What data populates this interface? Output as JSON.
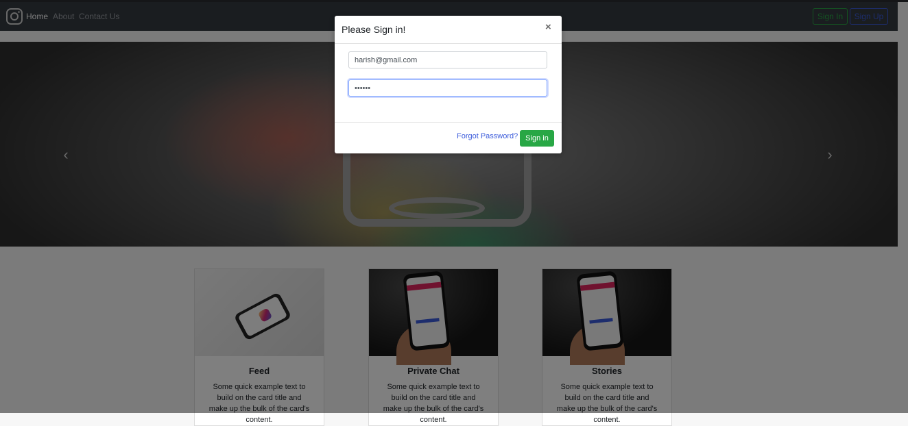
{
  "navbar": {
    "links": [
      {
        "label": "Home",
        "active": true
      },
      {
        "label": "About",
        "active": false
      },
      {
        "label": "Contact Us",
        "active": false
      }
    ],
    "sign_in_label": "Sign In",
    "sign_up_label": "Sign Up",
    "brand_icon": "instagram-icon"
  },
  "carousel": {
    "prev_icon": "chevron-left-icon",
    "next_icon": "chevron-right-icon",
    "prev_glyph": "‹",
    "next_glyph": "›"
  },
  "cards": [
    {
      "title": "Feed",
      "text": "Some quick example text to build on the card title and make up the bulk of the card's content."
    },
    {
      "title": "Private Chat",
      "text": "Some quick example text to build on the card title and make up the bulk of the card's content."
    },
    {
      "title": "Stories",
      "text": "Some quick example text to build on the card title and make up the bulk of the card's content."
    }
  ],
  "modal": {
    "title": "Please Sign in!",
    "close_glyph": "×",
    "email_value": "harish@gmail.com",
    "password_value": "••••••",
    "forgot_label": "Forgot Password?",
    "submit_label": "Sign in"
  },
  "colors": {
    "navbar_bg": "#343a40",
    "success": "#28a745",
    "primary": "#3b5bdb"
  }
}
